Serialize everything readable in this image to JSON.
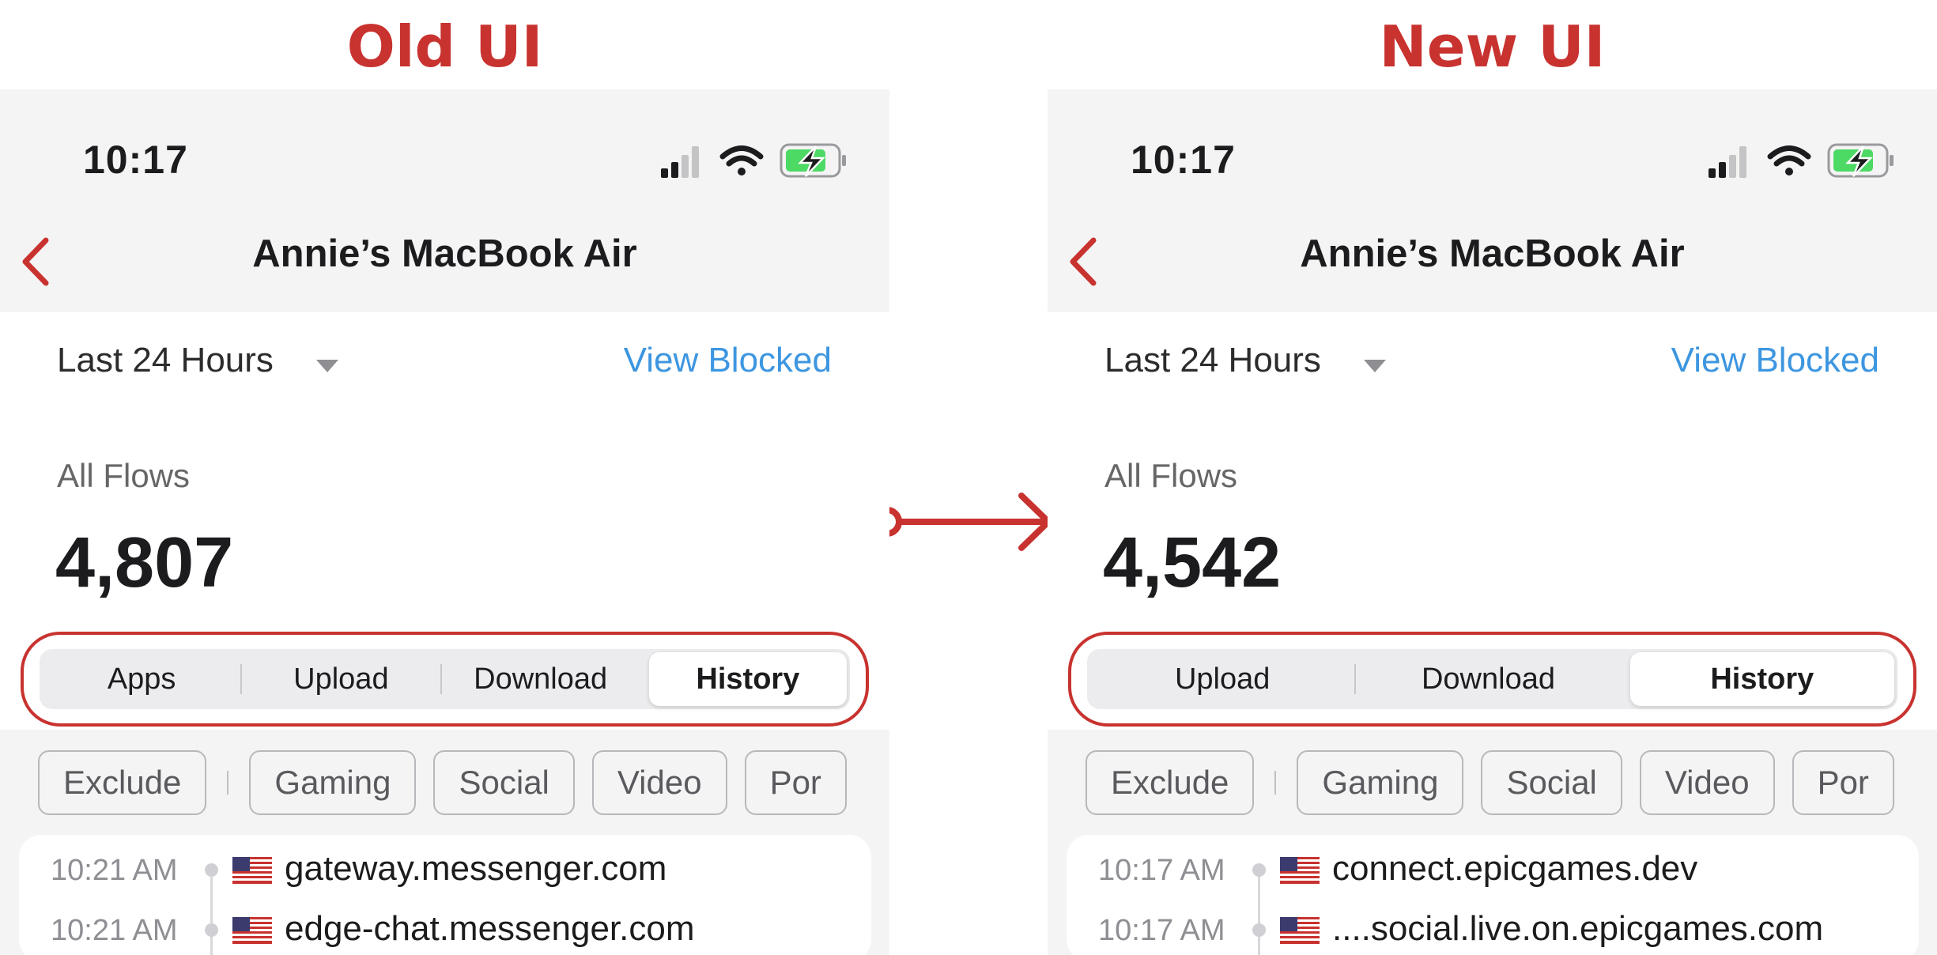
{
  "labels": {
    "old": "Old UI",
    "new": "New UI"
  },
  "colors": {
    "accent_red": "#c8322f",
    "link_blue": "#3d96e0",
    "bar_bg": "#f4f4f4"
  },
  "status_bar": {
    "time": "10:17",
    "icons": [
      "cellular-signal-icon",
      "wifi-icon",
      "battery-charging-icon"
    ]
  },
  "old_ui": {
    "nav_title": "Annie’s MacBook Air",
    "time_range": "Last 24 Hours",
    "view_blocked": "View Blocked",
    "flows_label": "All Flows",
    "flows_count": "4,807",
    "segments": [
      "Apps",
      "Upload",
      "Download",
      "History"
    ],
    "selected_segment": "History",
    "filters": [
      "Exclude",
      "Gaming",
      "Social",
      "Video",
      "Por"
    ],
    "rows": [
      {
        "time": "10:21 AM",
        "flag": "us-flag-icon",
        "domain": "gateway.messenger.com"
      },
      {
        "time": "10:21 AM",
        "flag": "us-flag-icon",
        "domain": "edge-chat.messenger.com"
      }
    ]
  },
  "new_ui": {
    "nav_title": "Annie’s MacBook Air",
    "time_range": "Last 24 Hours",
    "view_blocked": "View Blocked",
    "flows_label": "All Flows",
    "flows_count": "4,542",
    "segments": [
      "Upload",
      "Download",
      "History"
    ],
    "selected_segment": "History",
    "filters": [
      "Exclude",
      "Gaming",
      "Social",
      "Video",
      "Por"
    ],
    "rows": [
      {
        "time": "10:17 AM",
        "flag": "us-flag-icon",
        "domain": "connect.epicgames.dev"
      },
      {
        "time": "10:17 AM",
        "flag": "us-flag-icon",
        "domain": "....social.live.on.epicgames.com"
      }
    ]
  }
}
